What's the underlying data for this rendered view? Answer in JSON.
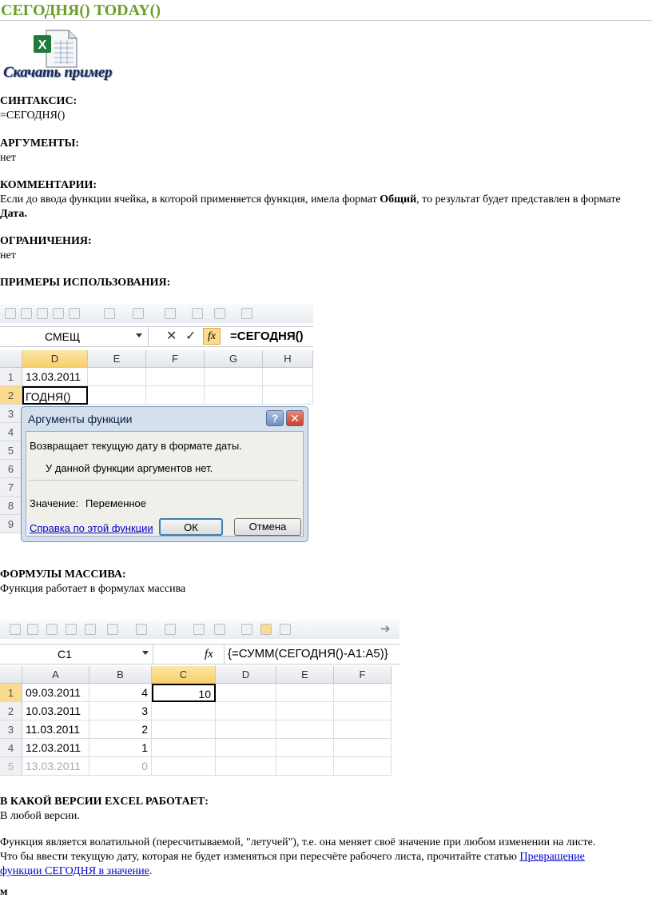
{
  "title": "СЕГОДНЯ() TODAY()",
  "download": {
    "label": "Скачать пример"
  },
  "syntax": {
    "heading": "СИНТАКСИС:",
    "text": "=СЕГОДНЯ()"
  },
  "arguments": {
    "heading": "АРГУМЕНТЫ:",
    "text": "нет"
  },
  "comments": {
    "heading": "КОММЕНТАРИИ:",
    "part1": "Если до ввода функции ячейка, в которой применяется функция, имела формат ",
    "bold1": "Общий",
    "part2": ", то результат будет представлен в формате ",
    "bold2": "Дата."
  },
  "limits": {
    "heading": "ОГРАНИЧЕНИЯ:",
    "text": "нет"
  },
  "examples": {
    "heading": "ПРИМЕРЫ ИСПОЛЬЗОВАНИЯ:",
    "namebox": "СМЕЩ",
    "formula": "=СЕГОДНЯ()",
    "fx": "fx",
    "columns": [
      "D",
      "E",
      "F",
      "G",
      "H"
    ],
    "rows": [
      "1",
      "2",
      "3",
      "4",
      "5",
      "6",
      "7",
      "8",
      "9"
    ],
    "cell_d1": "13.03.2011",
    "cell_d2": "ГОДНЯ()",
    "dialog": {
      "title": "Аргументы функции",
      "help_caption": "?",
      "close_caption": "✕",
      "description": "Возвращает текущую дату в формате даты.",
      "no_args": "У данной функции аргументов нет.",
      "value_label": "Значение:",
      "value": "Переменное",
      "help_link": "Справка по этой функции",
      "ok": "ОК",
      "cancel": "Отмена"
    }
  },
  "array_formulas": {
    "heading": "ФОРМУЛЫ МАССИВА:",
    "text": "Функция работает в формулах массива",
    "namebox": "C1",
    "fx": "fx",
    "formula": "{=СУММ(СЕГОДНЯ()-A1:A5)}",
    "columns": [
      "A",
      "B",
      "C",
      "D",
      "E",
      "F"
    ],
    "rows": [
      "1",
      "2",
      "3",
      "4",
      "5"
    ],
    "data": [
      {
        "a": "09.03.2011",
        "b": "4",
        "c": "10"
      },
      {
        "a": "10.03.2011",
        "b": "3",
        "c": ""
      },
      {
        "a": "11.03.2011",
        "b": "2",
        "c": ""
      },
      {
        "a": "12.03.2011",
        "b": "1",
        "c": ""
      },
      {
        "a": "13.03.2011",
        "b": "0",
        "c": ""
      }
    ]
  },
  "versions": {
    "heading": "В КАКОЙ ВЕРСИИ EXCEL РАБОТАЕТ:",
    "text": "В любой версии."
  },
  "volatile": {
    "text": "Функция является волатильной (пересчитываемой, \"летучей\"), т.е. она меняет своё значение при любом изменении на листе. Что бы ввести текущую дату, которая не будет изменяться при пересчёте рабочего листа, прочитайте статью ",
    "link": "Превращение функции СЕГОДНЯ в значение",
    "end": "."
  },
  "footer": "м"
}
